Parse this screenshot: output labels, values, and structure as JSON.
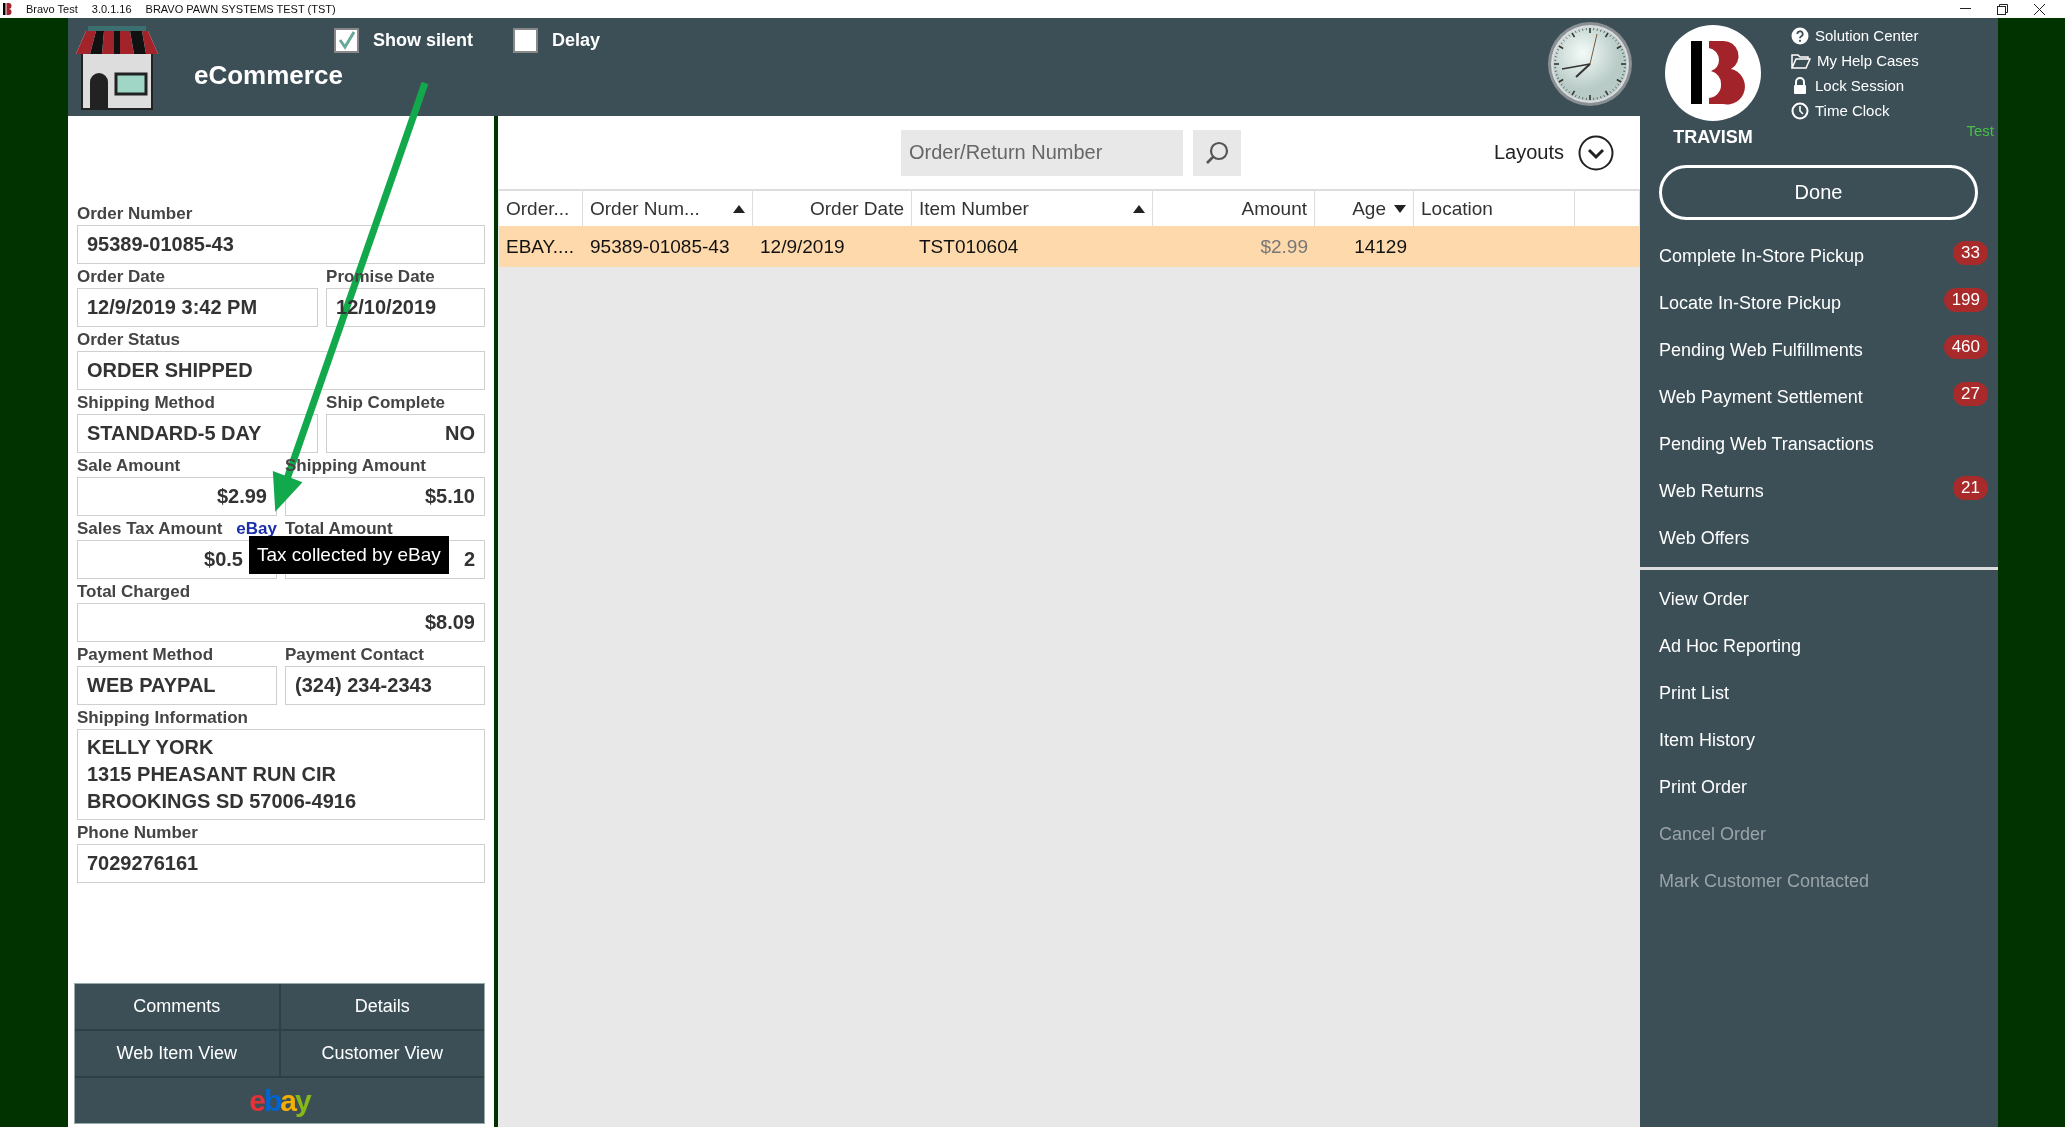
{
  "title_bar": {
    "app": "Bravo Test",
    "version": "3.0.1.16",
    "company": "BRAVO PAWN SYSTEMS TEST (TST)"
  },
  "header": {
    "title": "eCommerce",
    "options": [
      {
        "label": "Show silent",
        "checked": true
      },
      {
        "label": "Delay",
        "checked": false
      }
    ]
  },
  "order_form": {
    "rows": [
      {
        "kind": "single",
        "fields": [
          {
            "label": "Order Number",
            "value": "95389-01085-43",
            "kind": "text"
          }
        ]
      },
      {
        "kind": "wide_left",
        "fields": [
          {
            "label": "Order Date",
            "value": "12/9/2019 3:42 PM",
            "kind": "text"
          },
          {
            "label": "Promise Date",
            "value": "12/10/2019",
            "kind": "text"
          }
        ]
      },
      {
        "kind": "single",
        "fields": [
          {
            "label": "Order Status",
            "value": "ORDER SHIPPED",
            "kind": "text"
          }
        ]
      },
      {
        "kind": "wide_left",
        "fields": [
          {
            "label": "Shipping Method",
            "value": "STANDARD-5 DAY",
            "kind": "text"
          },
          {
            "label": "Ship Complete",
            "value": "NO",
            "kind": "numeric"
          }
        ]
      },
      {
        "kind": "even",
        "fields": [
          {
            "label": "Sale Amount",
            "value": "$2.99",
            "kind": "numeric"
          },
          {
            "label": "Shipping Amount",
            "value": "$5.10",
            "kind": "numeric"
          }
        ]
      },
      {
        "kind": "even",
        "tooltip": "Tax collected by eBay",
        "fields": [
          {
            "label": "Sales Tax Amount",
            "tag": "eBay",
            "value": "$0.5",
            "kind": "numeric"
          },
          {
            "label": "Total Amount",
            "value": "2",
            "kind": "numeric"
          }
        ]
      },
      {
        "kind": "single",
        "fields": [
          {
            "label": "Total Charged",
            "value": "$8.09",
            "kind": "numeric"
          }
        ]
      },
      {
        "kind": "even",
        "fields": [
          {
            "label": "Payment Method",
            "value": "WEB PAYPAL",
            "kind": "text"
          },
          {
            "label": "Payment Contact",
            "value": "(324) 234-2343",
            "kind": "text"
          }
        ]
      },
      {
        "kind": "single",
        "fields": [
          {
            "label": "Shipping Information",
            "lines": [
              "KELLY YORK",
              "1315 PHEASANT RUN CIR",
              "BROOKINGS SD 57006-4916"
            ],
            "kind": "text"
          }
        ]
      },
      {
        "kind": "single",
        "fields": [
          {
            "label": "Phone Number",
            "value": "7029276161",
            "kind": "text"
          }
        ]
      }
    ],
    "buttons": [
      "Comments",
      "Details",
      "Web Item View",
      "Customer View"
    ],
    "marketplace_logo": "ebay"
  },
  "table": {
    "search": {
      "placeholder": "Order/Return Number"
    },
    "layouts": "Layouts",
    "columns": [
      {
        "label": "Order...",
        "kind": "text",
        "sort_up": false,
        "sort_down": false
      },
      {
        "label": "Order Num...",
        "kind": "text",
        "sort_up": true,
        "sort_down": false
      },
      {
        "label": "Order Date",
        "kind": "date",
        "sort_up": false,
        "sort_down": false
      },
      {
        "label": "Item Number",
        "kind": "text",
        "sort_up": true,
        "sort_down": false
      },
      {
        "label": "Amount",
        "kind": "numeric",
        "sort_up": false,
        "sort_down": false
      },
      {
        "label": "Age",
        "kind": "numeric",
        "sort_up": false,
        "sort_down": true
      },
      {
        "label": "Location",
        "kind": "text",
        "sort_up": false,
        "sort_down": false
      },
      {
        "kind": "text",
        "sort_up": false,
        "sort_down": false
      }
    ],
    "rows": [
      {
        "selected": true,
        "cells": [
          "EBAY....",
          "95389-01085-43",
          "12/9/2019",
          "TST010604",
          "$2.99",
          "14129"
        ]
      }
    ]
  },
  "right_panel": {
    "user": "TRAVISM",
    "environment": "Test",
    "links": [
      {
        "kind": "help",
        "label": "Solution Center"
      },
      {
        "kind": "folder",
        "label": "My Help Cases"
      },
      {
        "kind": "lock",
        "label": "Lock Session"
      },
      {
        "kind": "clock",
        "label": "Time Clock"
      }
    ],
    "done": "Done",
    "primary_actions": [
      {
        "label": "Complete In-Store Pickup",
        "count": "33"
      },
      {
        "label": "Locate In-Store Pickup",
        "count": "199"
      },
      {
        "label": "Pending Web Fulfillments",
        "count": "460"
      },
      {
        "label": "Web Payment Settlement",
        "count": "27"
      },
      {
        "label": "Pending Web Transactions"
      },
      {
        "label": "Web Returns",
        "count": "21"
      },
      {
        "label": "Web Offers"
      }
    ],
    "secondary_actions": [
      {
        "label": "View Order",
        "disabled": false
      },
      {
        "label": "Ad Hoc Reporting",
        "disabled": false
      },
      {
        "label": "Print List",
        "disabled": false
      },
      {
        "label": "Item History",
        "disabled": false
      },
      {
        "label": "Print Order",
        "disabled": false
      },
      {
        "label": "Cancel Order",
        "disabled": true
      },
      {
        "label": "Mark Customer Contacted",
        "disabled": true
      }
    ]
  }
}
